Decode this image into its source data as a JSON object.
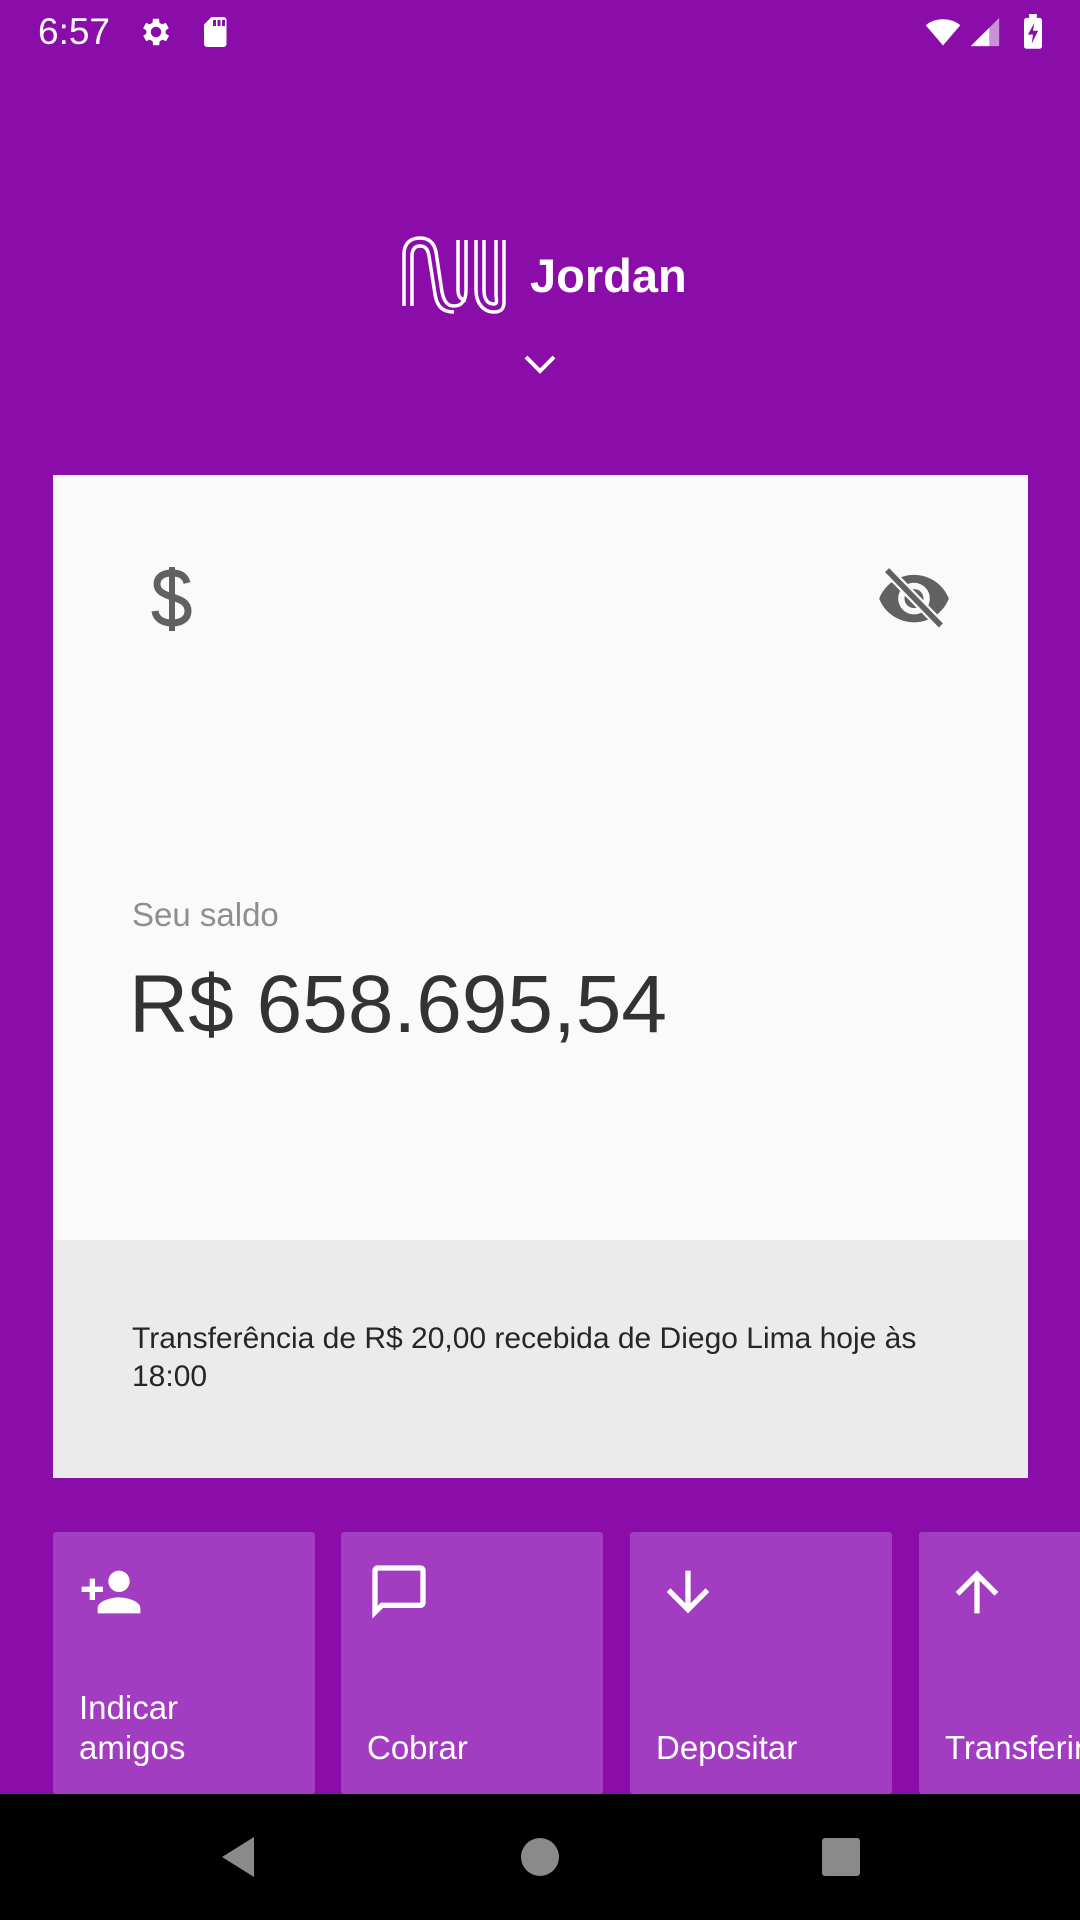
{
  "status_bar": {
    "time": "6:57",
    "icons": [
      "gear-icon",
      "sd-card-icon",
      "wifi-icon",
      "signal-icon",
      "battery-charging-icon"
    ]
  },
  "header": {
    "logo": "nu-logo",
    "user_name": "Jordan",
    "expand_icon": "chevron-down-icon"
  },
  "account_card": {
    "icon": "dollar-icon",
    "visibility_icon": "eye-off-icon",
    "balance_label": "Seu saldo",
    "balance_value": "R$ 658.695,54",
    "notification": "Transferência de R$ 20,00 recebida de Diego Lima hoje às 18:00"
  },
  "actions": [
    {
      "label": "Indicar\namigos",
      "icon": "person-add-icon"
    },
    {
      "label": "Cobrar",
      "icon": "chat-icon"
    },
    {
      "label": "Depositar",
      "icon": "arrow-down-icon"
    },
    {
      "label": "Transferir",
      "icon": "arrow-up-icon"
    }
  ],
  "nav_bar": {
    "buttons": [
      "back-icon",
      "home-icon",
      "recents-icon"
    ]
  },
  "colors": {
    "brand_purple": "#8A0DAA",
    "tile_purple": "#A23CC0",
    "card_bg": "#FAFAFA",
    "card_footer_bg": "#EBEBEB"
  }
}
